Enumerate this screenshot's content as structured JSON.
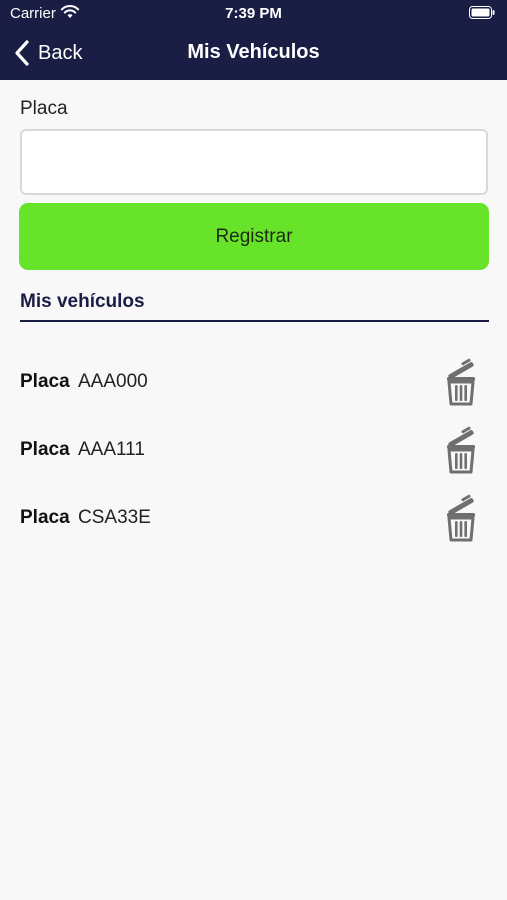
{
  "status_bar": {
    "carrier": "Carrier",
    "time": "7:39 PM",
    "wifi_icon": "wifi-icon",
    "battery_icon": "battery-icon"
  },
  "nav": {
    "back_label": "Back",
    "back_icon": "chevron-left-icon",
    "title": "Mis Vehículos"
  },
  "form": {
    "field_label": "Placa",
    "input_value": "",
    "input_placeholder": "",
    "submit_label": "Registrar"
  },
  "list": {
    "section_title": "Mis vehículos",
    "key_label": "Placa",
    "delete_icon": "trash-icon",
    "items": [
      {
        "plate": "AAA000"
      },
      {
        "plate": "AAA111"
      },
      {
        "plate": "CSA33E"
      }
    ]
  },
  "colors": {
    "nav_background": "#1b1e44",
    "button_green": "#67e42a",
    "page_background": "#f8f8f8",
    "icon_gray": "#6f6f6f"
  }
}
